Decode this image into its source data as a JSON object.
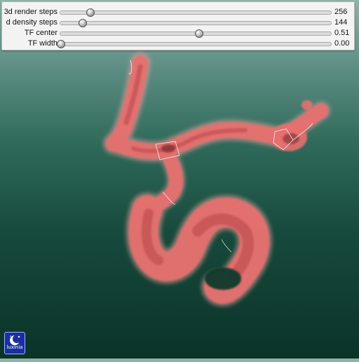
{
  "controls": {
    "sliders": [
      {
        "label": "3d render steps",
        "value": "256",
        "fraction": 0.11
      },
      {
        "label": "d density steps",
        "value": "144",
        "fraction": 0.08
      },
      {
        "label": "TF center",
        "value": "0.51",
        "fraction": 0.51
      },
      {
        "label": "TF width",
        "value": "0.00",
        "fraction": 0.0
      }
    ]
  },
  "viewport": {
    "object": "3d-vessel-volume-render",
    "background_top": "#8fb4aa",
    "background_bottom": "#0b3328",
    "vessel_color": "#e8706e"
  },
  "logo": {
    "text": "luxinia",
    "icon": "moon-star-icon"
  }
}
